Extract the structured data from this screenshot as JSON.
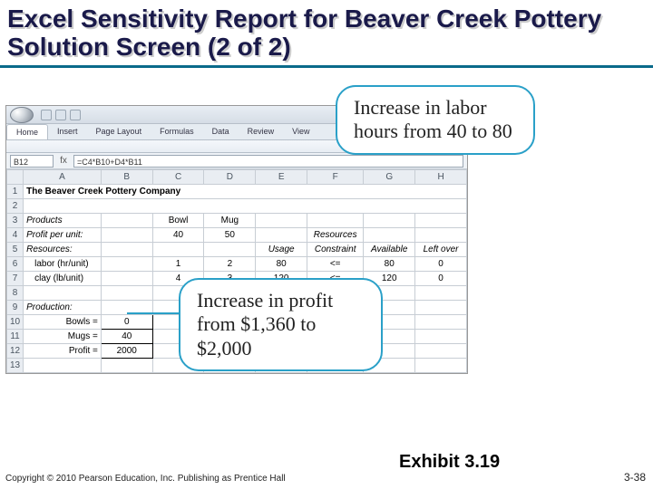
{
  "title_line1": "Excel Sensitivity Report for Beaver Creek Pottery",
  "title_line2": "Solution Screen (2 of 2)",
  "callout1": "Increase in labor hours from 40 to 80",
  "callout2": "Increase in profit from $1,360 to $2,000",
  "copyright": "Copyright © 2010 Pearson Education, Inc. Publishing as Prentice Hall",
  "exhibit": "Exhibit 3.19",
  "pagenum": "3-38",
  "excel": {
    "namebox": "B12",
    "formula": "=C4*B10+D4*B11",
    "tabs": [
      "Home",
      "Insert",
      "Page Layout",
      "Formulas",
      "Data",
      "Review",
      "View"
    ],
    "cols": [
      "A",
      "B",
      "C",
      "D",
      "E",
      "F",
      "G",
      "H"
    ],
    "row1_A": "The Beaver Creek Pottery Company",
    "row3_A": "Products",
    "row3_C": "Bowl",
    "row3_D": "Mug",
    "row4_A": "Profit per unit:",
    "row4_C": "40",
    "row4_D": "50",
    "row4_F": "Resources",
    "row5_A": "Resources:",
    "row5_E": "Usage",
    "row5_F": "Constraint",
    "row5_G": "Available",
    "row5_H": "Left over",
    "row6_A": "labor (hr/unit)",
    "row6_C": "1",
    "row6_D": "2",
    "row6_E": "80",
    "row6_F": "<=",
    "row6_G": "80",
    "row6_H": "0",
    "row7_A": "clay (lb/unit)",
    "row7_C": "4",
    "row7_D": "3",
    "row7_E": "120",
    "row7_F": "<=",
    "row7_G": "120",
    "row7_H": "0",
    "row9_A": "Production:",
    "row10_A": "Bowls =",
    "row10_B": "0",
    "row11_A": "Mugs =",
    "row11_B": "40",
    "row12_A": "Profit =",
    "row12_B": "2000"
  }
}
